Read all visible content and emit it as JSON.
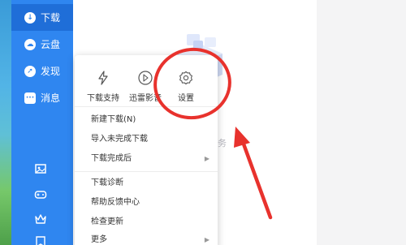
{
  "sidebar": {
    "items": [
      {
        "label": "下载",
        "icon": "download-icon"
      },
      {
        "label": "云盘",
        "icon": "cloud-icon"
      },
      {
        "label": "发现",
        "icon": "compass-icon"
      },
      {
        "label": "消息",
        "icon": "message-icon"
      }
    ],
    "bottom_icons": [
      "image-icon",
      "gamepad-icon",
      "crown-icon",
      "bookmark-icon"
    ]
  },
  "main": {
    "empty_hint_fragment": "务"
  },
  "menu": {
    "tools": [
      {
        "label": "下载支持",
        "icon": "lightning-icon"
      },
      {
        "label": "迅雷影音",
        "icon": "player-icon"
      },
      {
        "label": "设置",
        "icon": "gear-icon"
      }
    ],
    "items": [
      {
        "label": "新建下载(N)",
        "submenu": false
      },
      {
        "label": "导入未完成下载",
        "submenu": false
      },
      {
        "label": "下载完成后",
        "submenu": true
      },
      {
        "label": "下载诊断",
        "submenu": false
      },
      {
        "label": "帮助反馈中心",
        "submenu": false
      },
      {
        "label": "检查更新",
        "submenu": false
      },
      {
        "label": "更多",
        "submenu": true
      }
    ],
    "submenu_arrow": "▶"
  },
  "colors": {
    "sidebar": "#2f86f0",
    "sidebar_active": "#1f6ed8",
    "annotation": "#e8322d"
  }
}
